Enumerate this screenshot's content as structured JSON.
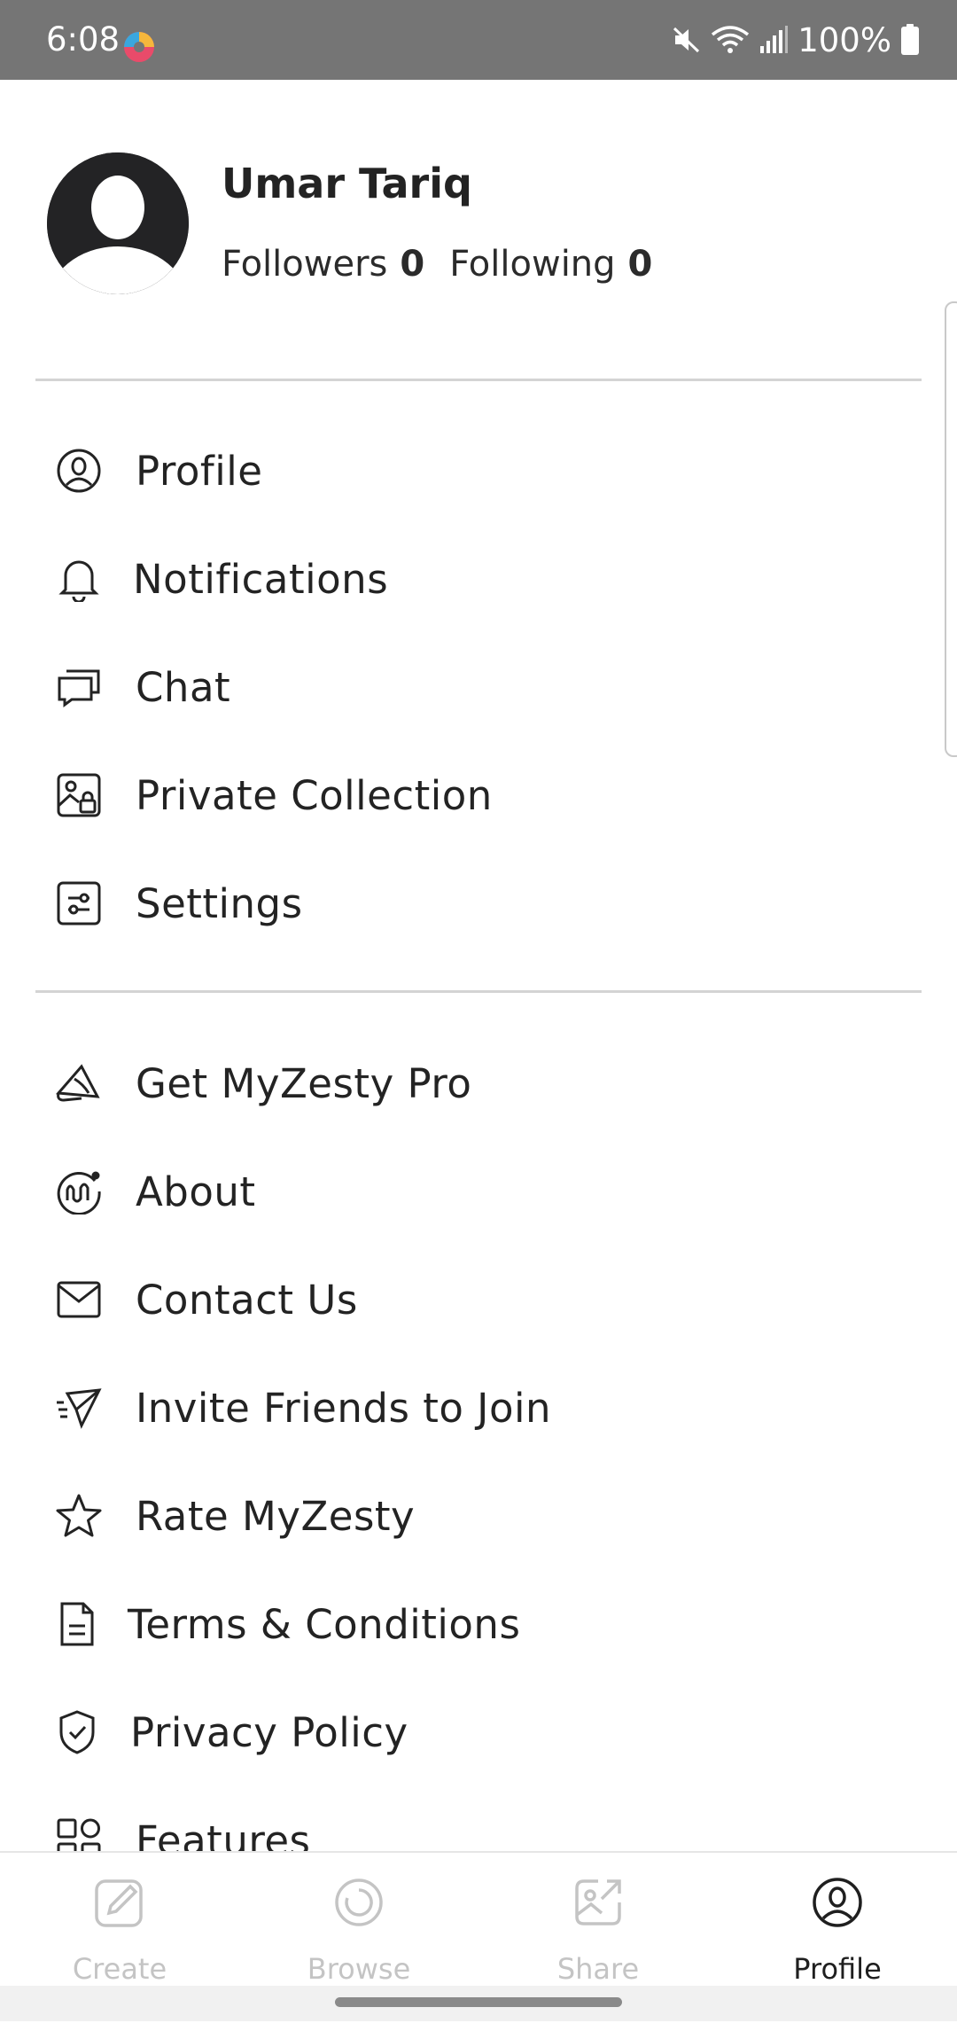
{
  "status_bar": {
    "time": "6:08",
    "battery": "100%",
    "icons": [
      "mute-icon",
      "wifi-icon",
      "signal-icon",
      "battery-icon"
    ]
  },
  "profile": {
    "name": "Umar Tariq",
    "followers_label": "Followers",
    "followers_count": "0",
    "following_label": "Following",
    "following_count": "0"
  },
  "menu_primary": [
    {
      "label": "Profile",
      "icon": "profile-icon"
    },
    {
      "label": "Notifications",
      "icon": "bell-icon"
    },
    {
      "label": "Chat",
      "icon": "chat-icon"
    },
    {
      "label": "Private Collection",
      "icon": "private-collection-icon"
    },
    {
      "label": "Settings",
      "icon": "settings-icon"
    }
  ],
  "menu_secondary": [
    {
      "label": "Get MyZesty Pro",
      "icon": "megaphone-icon"
    },
    {
      "label": "About",
      "icon": "about-icon"
    },
    {
      "label": "Contact Us",
      "icon": "mail-icon"
    },
    {
      "label": "Invite Friends to Join",
      "icon": "paper-plane-icon"
    },
    {
      "label": "Rate MyZesty",
      "icon": "star-icon"
    },
    {
      "label": "Terms & Conditions",
      "icon": "document-icon"
    },
    {
      "label": "Privacy Policy",
      "icon": "shield-icon"
    },
    {
      "label": "Features",
      "icon": "features-icon"
    }
  ],
  "bottom_nav": [
    {
      "label": "Create",
      "icon": "pencil-icon",
      "active": false
    },
    {
      "label": "Browse",
      "icon": "browse-icon",
      "active": false
    },
    {
      "label": "Share",
      "icon": "share-icon",
      "active": false
    },
    {
      "label": "Profile",
      "icon": "profile-icon",
      "active": true
    }
  ],
  "colors": {
    "status_bar_bg": "#757575",
    "text": "#232323",
    "inactive_nav": "#c4c4c4",
    "divider": "#d4d4d4"
  }
}
